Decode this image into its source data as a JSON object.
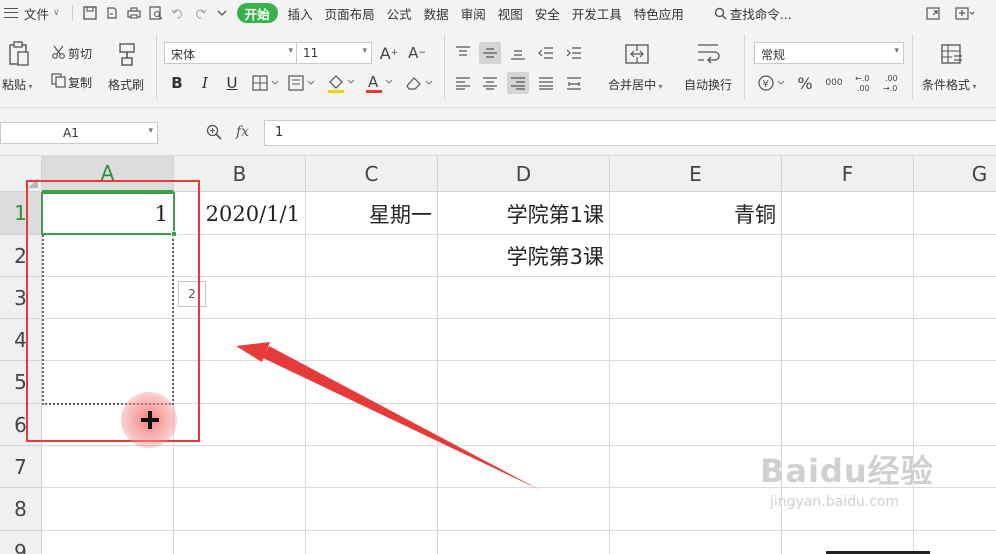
{
  "menu": {
    "file": "文件",
    "tabs": [
      "开始",
      "插入",
      "页面布局",
      "公式",
      "数据",
      "审阅",
      "视图",
      "安全",
      "开发工具",
      "特色应用"
    ],
    "search": "查找命令..."
  },
  "ribbon": {
    "paste": "粘贴",
    "cut": "剪切",
    "copy": "复制",
    "format_painter": "格式刷",
    "font_name": "宋体",
    "font_size": "11",
    "bold": "B",
    "italic": "I",
    "underline": "U",
    "font_color_letter": "A",
    "merge_center": "合并居中",
    "wrap_text": "自动换行",
    "number_format": "常规",
    "percent": "%",
    "thousands": "000",
    "inc_decimal": "+.0\n.00",
    "dec_decimal": ".00\n→.0",
    "conditional_format": "条件格式",
    "colors": {
      "active_tab": "#38b24a",
      "font_color_bar": "#e53b3b",
      "fill_color_bar": "#f2d400"
    }
  },
  "formula_bar": {
    "name_box": "A1",
    "fx": "fx",
    "content": "1"
  },
  "sheet": {
    "columns": [
      "A",
      "B",
      "C",
      "D",
      "E",
      "F",
      "G"
    ],
    "rows": [
      "1",
      "2",
      "3",
      "4",
      "5",
      "6",
      "7",
      "8",
      "9"
    ],
    "selected_cell": "A1",
    "cells": {
      "A1": "1",
      "B1": "2020/1/1",
      "C1": "星期一",
      "D1": "学院第1课",
      "E1": "青铜",
      "D2": "学院第3课"
    },
    "fill_tooltip": "2",
    "colors": {
      "selection": "#3d9f48",
      "annotation": "#e53b3b"
    }
  },
  "watermark": {
    "main": "Baidu经验",
    "sub": "jingyan.baidu.com"
  }
}
